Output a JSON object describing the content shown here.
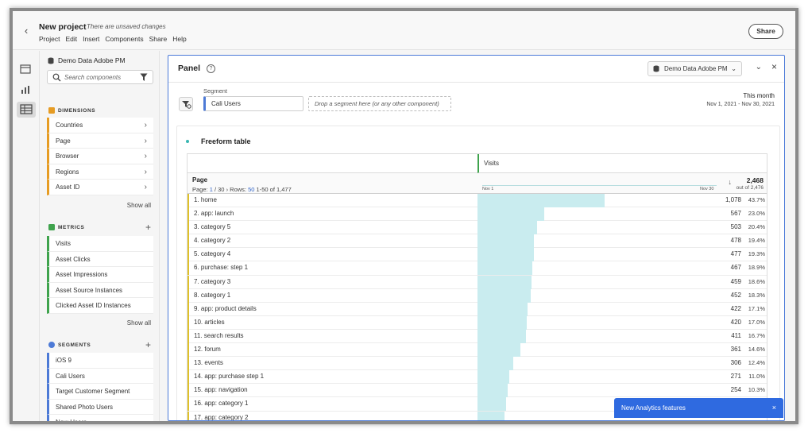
{
  "header": {
    "back_label": "‹",
    "project_title": "New project",
    "unsaved": "There are unsaved changes",
    "menu": [
      "Project",
      "Edit",
      "Insert",
      "Components",
      "Share",
      "Help"
    ],
    "share_label": "Share"
  },
  "left_panel": {
    "report_suite": "Demo Data Adobe PM",
    "search_placeholder": "Search components",
    "dimensions_label": "DIMENSIONS",
    "dimensions": [
      "Countries",
      "Page",
      "Browser",
      "Regions",
      "Asset ID"
    ],
    "metrics_label": "METRICS",
    "metrics": [
      "Visits",
      "Asset Clicks",
      "Asset Impressions",
      "Asset Source Instances",
      "Clicked Asset ID Instances"
    ],
    "segments_label": "SEGMENTS",
    "segments": [
      "iOS 9",
      "Cali Users",
      "Target Customer Segment",
      "Shared Photo Users",
      "New Users"
    ],
    "show_all": "Show all",
    "colors": {
      "dimension": "#e69c24",
      "metric": "#3fa34d",
      "segment": "#4d7ad6"
    }
  },
  "panel": {
    "title": "Panel",
    "help": "?",
    "report_suite": "Demo Data Adobe PM",
    "segment_label": "Segment",
    "segment_chip": "Cali Users",
    "segment_drop": "Drop a segment here (or any other component)",
    "date_label": "This month",
    "date_range": "Nov 1, 2021 - Nov 30, 2021"
  },
  "freeform": {
    "title": "Freeform table",
    "metric_name": "Visits",
    "dimension_name": "Page",
    "page_text": "Page:",
    "page_num": "1",
    "page_total": "/ 30",
    "rows_text": "Rows:",
    "rows_num": "50",
    "range": "1-50 of 1,477",
    "total": "2,468",
    "out_of": "out of 2,476",
    "spark_start": "Nov 1",
    "spark_end": "Nov 30",
    "max_value": 2468,
    "rows": [
      {
        "label": "1. home",
        "value": 1078,
        "display": "1,078",
        "pct": "43.7%"
      },
      {
        "label": "2. app: launch",
        "value": 567,
        "display": "567",
        "pct": "23.0%"
      },
      {
        "label": "3. category 5",
        "value": 503,
        "display": "503",
        "pct": "20.4%"
      },
      {
        "label": "4. category 2",
        "value": 478,
        "display": "478",
        "pct": "19.4%"
      },
      {
        "label": "5. category 4",
        "value": 477,
        "display": "477",
        "pct": "19.3%"
      },
      {
        "label": "6. purchase: step 1",
        "value": 467,
        "display": "467",
        "pct": "18.9%"
      },
      {
        "label": "7. category 3",
        "value": 459,
        "display": "459",
        "pct": "18.6%"
      },
      {
        "label": "8. category 1",
        "value": 452,
        "display": "452",
        "pct": "18.3%"
      },
      {
        "label": "9. app: product details",
        "value": 422,
        "display": "422",
        "pct": "17.1%"
      },
      {
        "label": "10. articles",
        "value": 420,
        "display": "420",
        "pct": "17.0%"
      },
      {
        "label": "11. search results",
        "value": 411,
        "display": "411",
        "pct": "16.7%"
      },
      {
        "label": "12. forum",
        "value": 361,
        "display": "361",
        "pct": "14.6%"
      },
      {
        "label": "13. events",
        "value": 306,
        "display": "306",
        "pct": "12.4%"
      },
      {
        "label": "14. app: purchase step 1",
        "value": 271,
        "display": "271",
        "pct": "11.0%"
      },
      {
        "label": "15. app: navigation",
        "value": 254,
        "display": "254",
        "pct": "10.3%"
      },
      {
        "label": "16. app: category 1",
        "value": 240,
        "display": "",
        "pct": ""
      },
      {
        "label": "17. app: category 2",
        "value": 232,
        "display": "",
        "pct": ""
      }
    ]
  },
  "toast": {
    "label": "New Analytics features",
    "close": "×"
  }
}
